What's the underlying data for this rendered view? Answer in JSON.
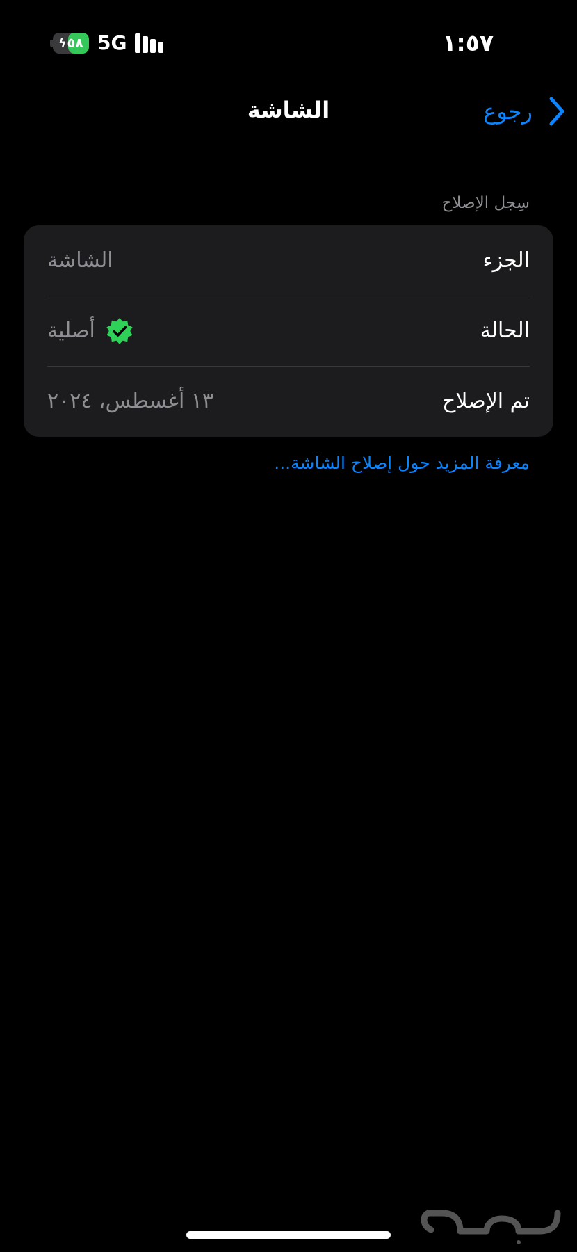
{
  "status_bar": {
    "time": "١:٥٧",
    "network": "5G",
    "battery": {
      "level_text": "٥٨",
      "level_fraction": 0.58,
      "charging": true,
      "charging_icon": "bolt-icon",
      "fill_color": "#34c759"
    },
    "signal_bars": 4
  },
  "nav": {
    "title": "الشاشة",
    "back_label": "رجوع",
    "back_icon": "chevron-right-icon"
  },
  "section": {
    "header": "سِجل الإصلاح",
    "rows": [
      {
        "label": "الجزء",
        "value": "الشاشة"
      },
      {
        "label": "الحالة",
        "value": "أصلية",
        "icon": "verified-badge-icon",
        "icon_color": "#30d158"
      },
      {
        "label": "تم الإصلاح",
        "value": "١٣ أغسطس، ٢٠٢٤"
      }
    ]
  },
  "learn_more_link": "معرفة المزيد حول إصلاح الشاشة...",
  "watermark": "حراج",
  "colors": {
    "background": "#000000",
    "card": "#1c1c1e",
    "accent": "#0a84ff",
    "secondary_text": "#8e8e93",
    "separator": "#38383a"
  }
}
